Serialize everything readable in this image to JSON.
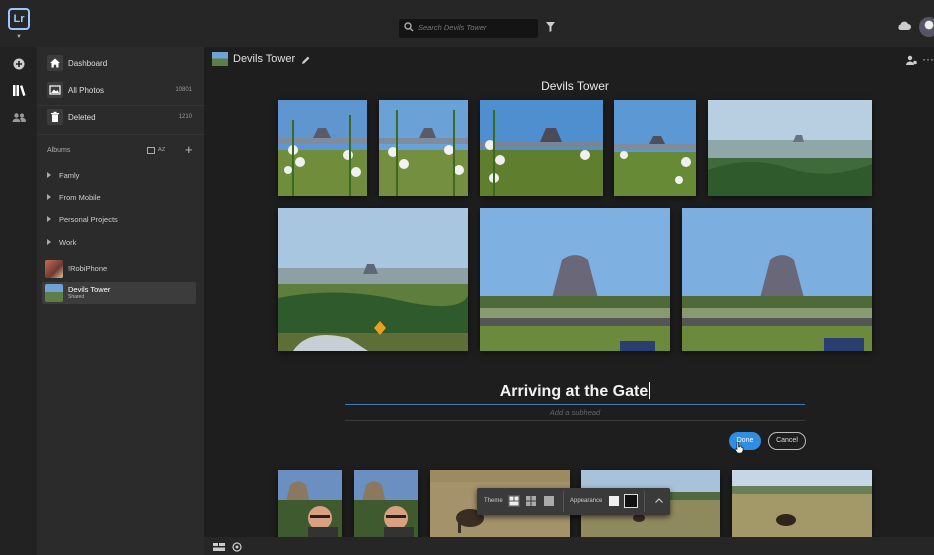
{
  "app": {
    "logo_text": "Lr"
  },
  "search": {
    "placeholder": "Search Devils Tower"
  },
  "sidebar": {
    "nav": [
      {
        "label": "Dashboard",
        "count": ""
      },
      {
        "label": "All Photos",
        "count": "10801"
      },
      {
        "label": "Deleted",
        "count": "1210"
      }
    ],
    "albums_label": "Albums",
    "sort_label": "A Z",
    "folders": [
      "Famly",
      "From Mobile",
      "Personal Projects",
      "Work"
    ],
    "albums": [
      {
        "label": "!RobiPhone",
        "sub": ""
      },
      {
        "label": "Devils Tower",
        "sub": "Shared"
      }
    ]
  },
  "main": {
    "album_title": "Devils Tower",
    "page_title": "Devils Tower",
    "text_block": {
      "heading": "Arriving at the Gate",
      "subhead_placeholder": "Add a subhead"
    },
    "done_label": "Done",
    "cancel_label": "Cancel"
  },
  "theme_bar": {
    "theme_label": "Theme",
    "appearance_label": "Appearance"
  },
  "colors": {
    "accent": "#2f8de4",
    "background": "#1e1e1e",
    "sidebar": "#2b2b2b"
  }
}
